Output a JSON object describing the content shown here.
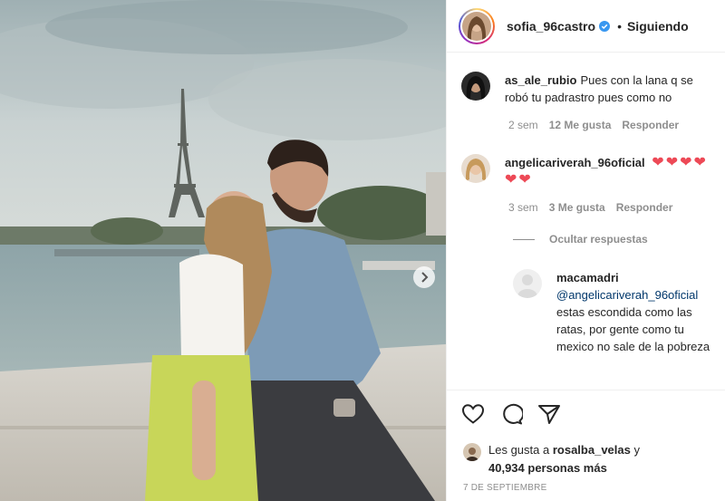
{
  "post": {
    "photo": {
      "alt": ""
    },
    "header": {
      "username": "sofia_96castro",
      "verified": true,
      "separator": "•",
      "follow_status": "Siguiendo"
    },
    "comments": [
      {
        "username": "as_ale_rubio",
        "text": "Pues con la lana q se robó tu padrastro pues como no",
        "time": "2 sem",
        "likes": "12 Me gusta",
        "reply": "Responder"
      },
      {
        "username": "angelicariverah_96oficial",
        "text": "❤❤❤❤❤❤",
        "time": "3 sem",
        "likes": "3 Me gusta",
        "reply": "Responder"
      }
    ],
    "hide_replies": "Ocultar respuestas",
    "reply": {
      "username": "macamadri",
      "mention": "@angelicariverah_96oficial",
      "text": "estas escondida como las ratas, por gente como tu mexico no sale de la pobreza"
    },
    "likes": {
      "prefix": "Les gusta a",
      "user": "rosalba_velas",
      "joiner": "y",
      "count": "40,934 personas más"
    },
    "date": "7 DE SEPTIEMBRE",
    "icons": {
      "like": "heart-outline-icon",
      "comment": "comment-bubble-icon",
      "share": "paper-plane-icon",
      "next": "chevron-right-icon",
      "verified": "verified-badge-icon"
    },
    "colors": {
      "verified": "#3897f0",
      "heart": "#ed4956",
      "mention": "#00376b",
      "muted": "#8e8e8e",
      "text": "#262626"
    }
  }
}
